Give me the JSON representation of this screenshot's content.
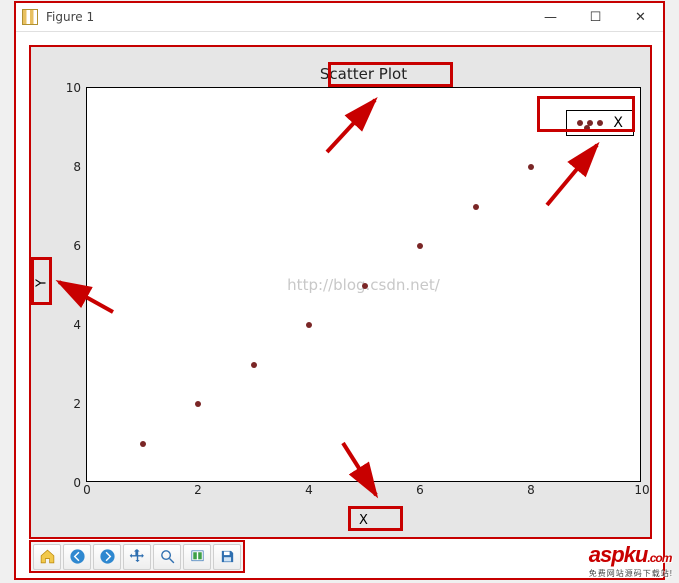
{
  "window": {
    "title": "Figure 1",
    "min_label": "—",
    "max_label": "▢",
    "close_label": "✕"
  },
  "watermark": "http://blog.csdn.net/",
  "brand": {
    "name": "aspku",
    "suffix": ".com",
    "tagline": "免费网站源码下载站!"
  },
  "toolbar": {
    "home": "home-icon",
    "back": "arrow-left-icon",
    "forward": "arrow-right-icon",
    "pan": "move-icon",
    "zoom": "zoom-icon",
    "configure": "configure-icon",
    "save": "save-icon"
  },
  "chart_data": {
    "type": "scatter",
    "title": "Scatter Plot",
    "xlabel": "X",
    "ylabel": "Y",
    "xlim": [
      0,
      10
    ],
    "ylim": [
      0,
      10
    ],
    "xticks": [
      0,
      2,
      4,
      6,
      8,
      10
    ],
    "yticks": [
      0,
      2,
      4,
      6,
      8,
      10
    ],
    "series": [
      {
        "name": "X",
        "color": "#7a2626",
        "x": [
          1,
          2,
          3,
          4,
          5,
          6,
          7,
          8,
          9
        ],
        "y": [
          1,
          2,
          3,
          4,
          5,
          6,
          7,
          8,
          9
        ]
      }
    ],
    "legend": {
      "position": "upper-right"
    }
  }
}
